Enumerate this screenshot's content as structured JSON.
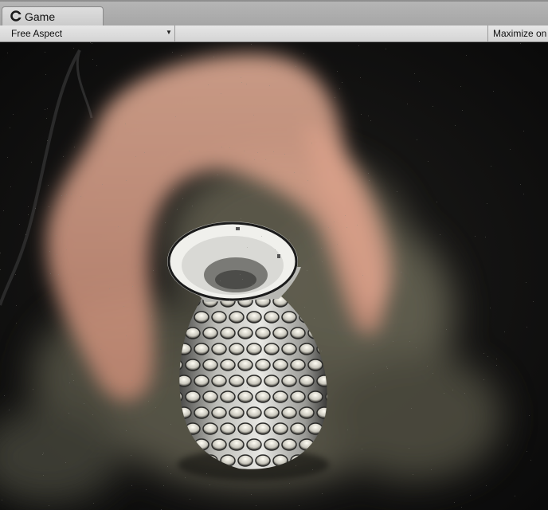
{
  "window": {
    "tab_title": "Game"
  },
  "toolbar": {
    "aspect_label": "Free Aspect",
    "maximize_label": "Maximize on Play"
  },
  "scene": {
    "object": "perforated-vase",
    "background": "camera-feed-dark",
    "effect": "smoke-particles"
  },
  "colors": {
    "tab_bg": "#d6d6d6",
    "toolbar_bg": "#dedede",
    "viewport_bg": "#121212"
  }
}
